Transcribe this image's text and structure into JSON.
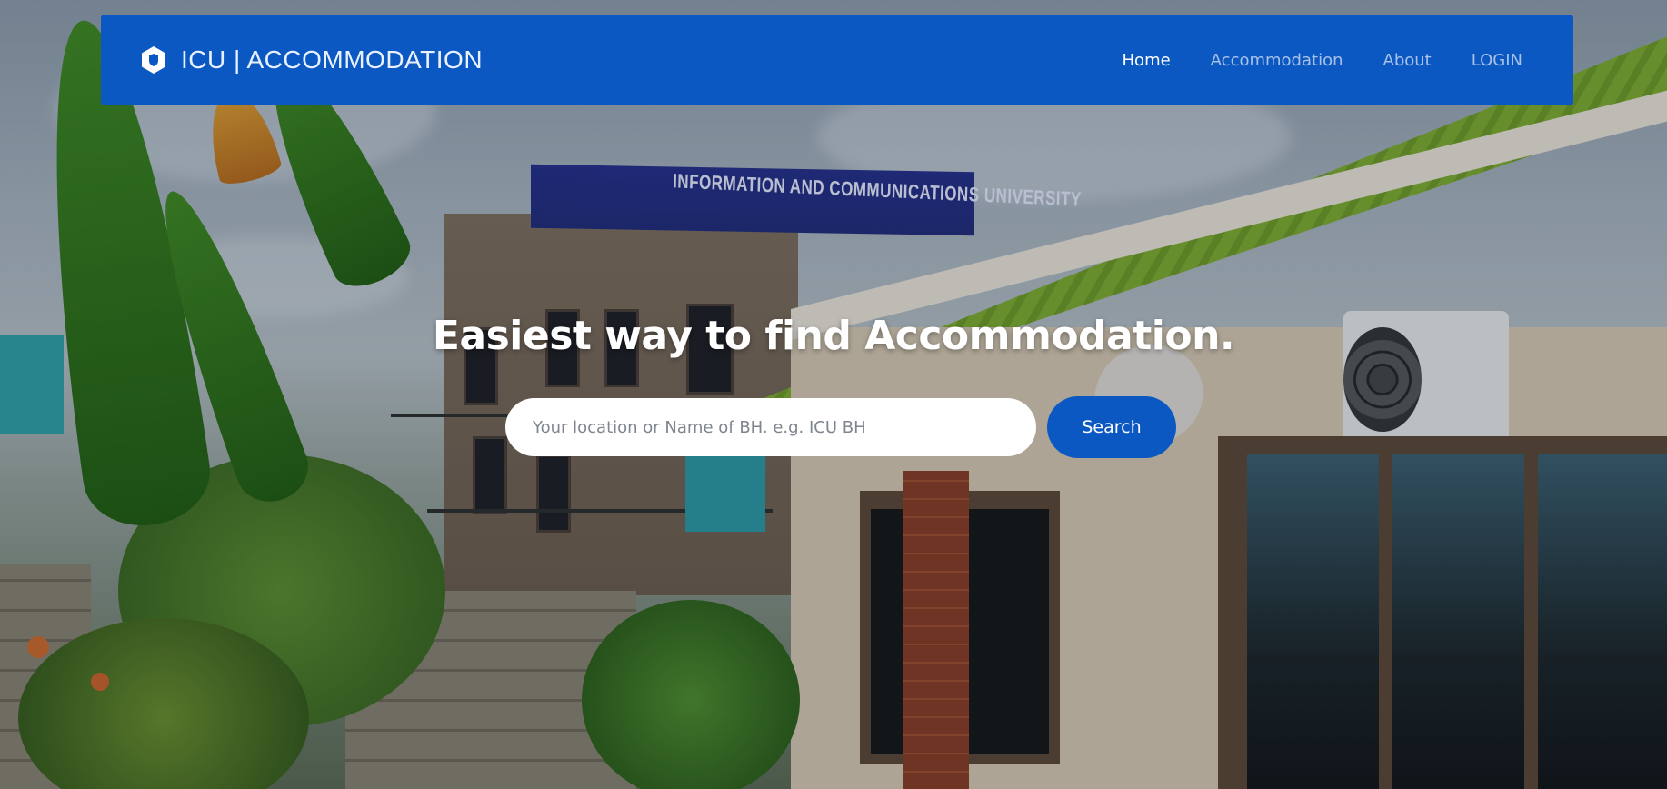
{
  "brand": {
    "icon": "hexagon-shield-icon",
    "name": "ICU | ACCOMMODATION"
  },
  "nav": {
    "items": [
      {
        "label": "Home",
        "active": true
      },
      {
        "label": "Accommodation",
        "active": false
      },
      {
        "label": "About",
        "active": false
      },
      {
        "label": "LOGIN",
        "active": false
      }
    ]
  },
  "hero": {
    "background": "photo of university building and student house",
    "building_sign": "INFORMATION AND COMMUNICATIONS UNIVERSITY",
    "title": "Easiest way to find Accommodation.",
    "search": {
      "placeholder": "Your location or Name of BH. e.g. ICU BH",
      "value": "",
      "button_label": "Search"
    }
  },
  "colors": {
    "primary": "#0b58c2",
    "nav_text": "#a9c2e8",
    "nav_active": "#ffffff"
  }
}
